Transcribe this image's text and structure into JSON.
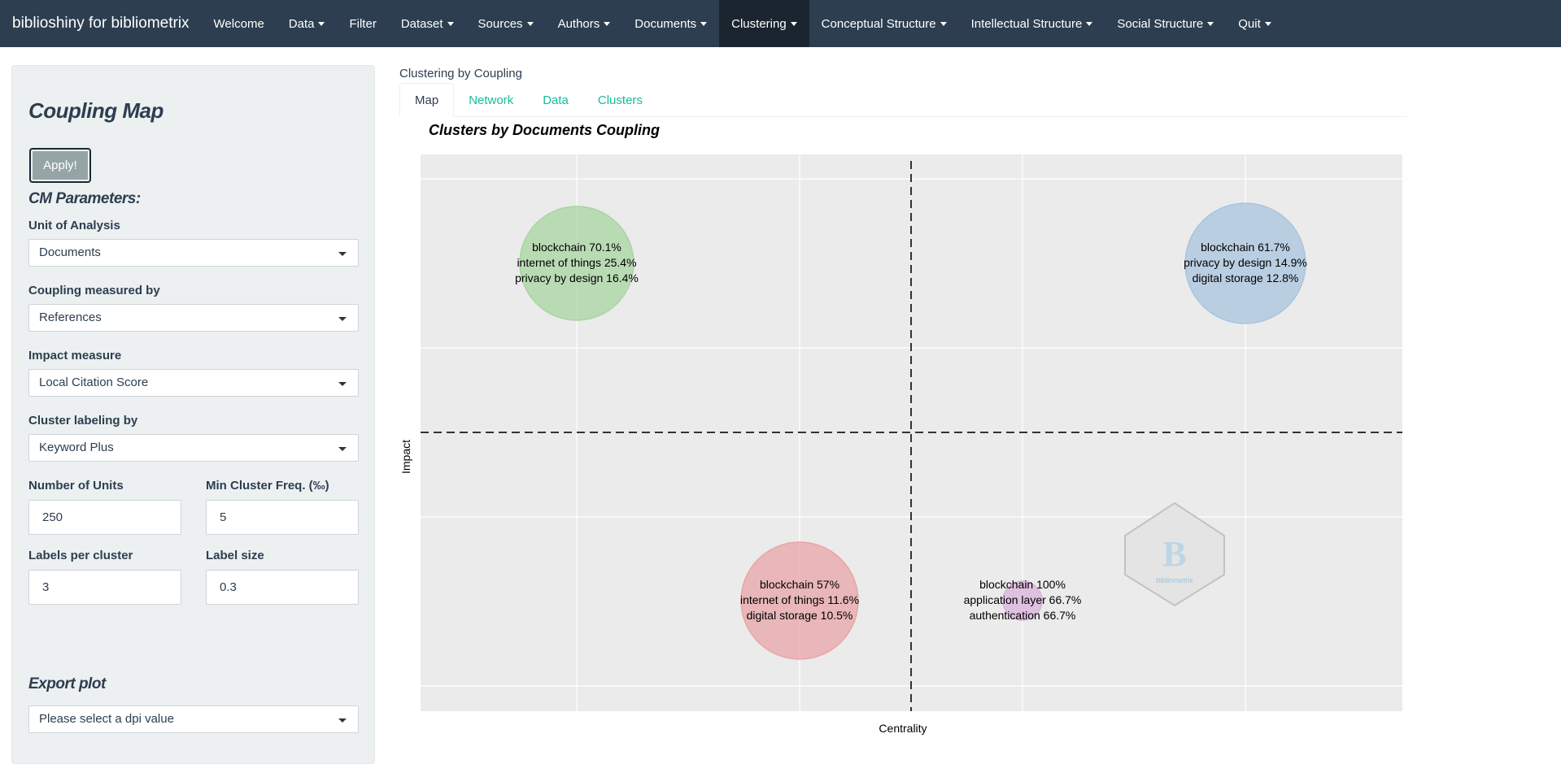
{
  "navbar": {
    "brand": "biblioshiny for bibliometrix",
    "items": [
      {
        "label": "Welcome",
        "dropdown": false,
        "active": false
      },
      {
        "label": "Data",
        "dropdown": true,
        "active": false
      },
      {
        "label": "Filter",
        "dropdown": false,
        "active": false
      },
      {
        "label": "Dataset",
        "dropdown": true,
        "active": false
      },
      {
        "label": "Sources",
        "dropdown": true,
        "active": false
      },
      {
        "label": "Authors",
        "dropdown": true,
        "active": false
      },
      {
        "label": "Documents",
        "dropdown": true,
        "active": false
      },
      {
        "label": "Clustering",
        "dropdown": true,
        "active": true
      },
      {
        "label": "Conceptual Structure",
        "dropdown": true,
        "active": false
      },
      {
        "label": "Intellectual Structure",
        "dropdown": true,
        "active": false
      },
      {
        "label": "Social Structure",
        "dropdown": true,
        "active": false
      },
      {
        "label": "Quit",
        "dropdown": true,
        "active": false
      }
    ]
  },
  "sidebar": {
    "title": "Coupling Map",
    "apply_label": "Apply!",
    "params_title": "CM Parameters:",
    "unit_label": "Unit of Analysis",
    "unit_value": "Documents",
    "coupling_label": "Coupling measured by",
    "coupling_value": "References",
    "impact_label": "Impact measure",
    "impact_value": "Local Citation Score",
    "labeling_label": "Cluster labeling by",
    "labeling_value": "Keyword Plus",
    "num_units_label": "Number of Units",
    "num_units_value": "250",
    "min_freq_label": "Min Cluster Freq. (‰)",
    "min_freq_value": "5",
    "labels_per_cluster_label": "Labels per cluster",
    "labels_per_cluster_value": "3",
    "label_size_label": "Label size",
    "label_size_value": "0.3",
    "export_title": "Export plot",
    "dpi_placeholder": "Please select a dpi value"
  },
  "main": {
    "section_label": "Clustering by Coupling",
    "tabs": [
      "Map",
      "Network",
      "Data",
      "Clusters"
    ],
    "active_tab": "Map"
  },
  "chart_data": {
    "type": "scatter",
    "title": "Clusters by Documents Coupling",
    "xlabel": "Centrality",
    "ylabel": "Impact",
    "grid": true,
    "background": "#ebebeb",
    "watermark": "bibliometrix",
    "clusters": [
      {
        "color": "#a8d5a0",
        "labels": [
          "blockchain 70.1%",
          "internet of things 25.4%",
          "privacy by design 16.4%"
        ],
        "size": "large"
      },
      {
        "color": "#a9c4df",
        "labels": [
          "blockchain 61.7%",
          "privacy by design 14.9%",
          "digital storage 12.8%"
        ],
        "size": "large"
      },
      {
        "color": "#e8a6a8",
        "labels": [
          "blockchain 57%",
          "internet of things 11.6%",
          "digital storage 10.5%"
        ],
        "size": "large"
      },
      {
        "color": "#d9b3d9",
        "labels": [
          "blockchain 100%",
          "application layer 66.7%",
          "authentication 66.7%"
        ],
        "size": "small"
      }
    ]
  }
}
